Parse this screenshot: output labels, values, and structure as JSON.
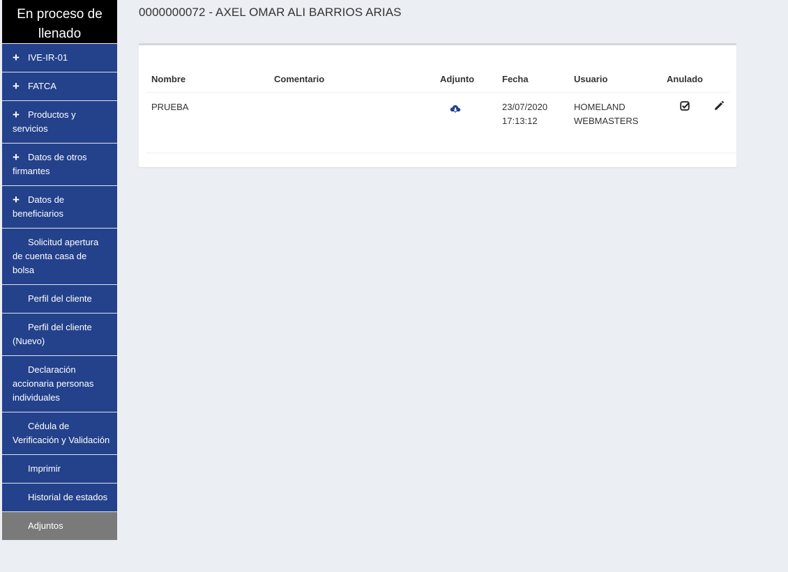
{
  "sidebar": {
    "status": "En proceso de llenado",
    "items": [
      {
        "label": "IVE-IR-01",
        "icon": "plus-icon"
      },
      {
        "label": "FATCA",
        "icon": "plus-icon"
      },
      {
        "label": "Productos y servicios",
        "icon": "plus-icon"
      },
      {
        "label": "Datos de otros firmantes",
        "icon": "plus-icon"
      },
      {
        "label": "Datos de beneficiarios",
        "icon": "plus-icon"
      },
      {
        "label": "Solicitud apertura de cuenta casa de bolsa",
        "icon": ""
      },
      {
        "label": "Perfil del cliente",
        "icon": ""
      },
      {
        "label": "Perfil del cliente (Nuevo)",
        "icon": ""
      },
      {
        "label": "Declaración accionaria personas individuales",
        "icon": ""
      },
      {
        "label": "Cédula de Verificación y Validación",
        "icon": ""
      },
      {
        "label": "Imprimir",
        "icon": ""
      },
      {
        "label": "Historial de estados",
        "icon": ""
      },
      {
        "label": "Adjuntos",
        "icon": "",
        "active": true
      }
    ]
  },
  "page": {
    "title": "0000000072 - AXEL OMAR ALI BARRIOS ARIAS"
  },
  "table": {
    "headers": {
      "nombre": "Nombre",
      "comentario": "Comentario",
      "adjunto": "Adjunto",
      "fecha": "Fecha",
      "usuario": "Usuario",
      "anulado": "Anulado"
    },
    "rows": [
      {
        "nombre": "PRUEBA",
        "comentario": "",
        "adjunto_icon": "cloud-download-icon",
        "fecha": "23/07/2020 17:13:12",
        "usuario": "HOMELAND WEBMASTERS",
        "anulado_icon": "checkbox-checked-icon",
        "edit_icon": "pencil-icon"
      }
    ]
  },
  "colors": {
    "sidebar_bg": "#24418b",
    "sidebar_active": "#7a7a7a",
    "status_bg": "#000000",
    "page_bg": "#ebeef3"
  }
}
